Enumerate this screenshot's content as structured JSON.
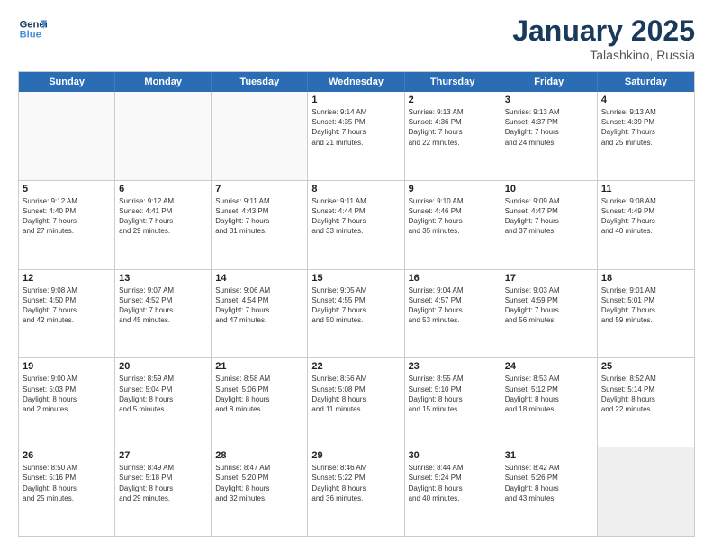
{
  "header": {
    "logo_line1": "General",
    "logo_line2": "Blue",
    "month_year": "January 2025",
    "location": "Talashkino, Russia"
  },
  "weekdays": [
    "Sunday",
    "Monday",
    "Tuesday",
    "Wednesday",
    "Thursday",
    "Friday",
    "Saturday"
  ],
  "rows": [
    [
      {
        "day": "",
        "info": "",
        "empty": true
      },
      {
        "day": "",
        "info": "",
        "empty": true
      },
      {
        "day": "",
        "info": "",
        "empty": true
      },
      {
        "day": "1",
        "info": "Sunrise: 9:14 AM\nSunset: 4:35 PM\nDaylight: 7 hours\nand 21 minutes."
      },
      {
        "day": "2",
        "info": "Sunrise: 9:13 AM\nSunset: 4:36 PM\nDaylight: 7 hours\nand 22 minutes."
      },
      {
        "day": "3",
        "info": "Sunrise: 9:13 AM\nSunset: 4:37 PM\nDaylight: 7 hours\nand 24 minutes."
      },
      {
        "day": "4",
        "info": "Sunrise: 9:13 AM\nSunset: 4:39 PM\nDaylight: 7 hours\nand 25 minutes."
      }
    ],
    [
      {
        "day": "5",
        "info": "Sunrise: 9:12 AM\nSunset: 4:40 PM\nDaylight: 7 hours\nand 27 minutes."
      },
      {
        "day": "6",
        "info": "Sunrise: 9:12 AM\nSunset: 4:41 PM\nDaylight: 7 hours\nand 29 minutes."
      },
      {
        "day": "7",
        "info": "Sunrise: 9:11 AM\nSunset: 4:43 PM\nDaylight: 7 hours\nand 31 minutes."
      },
      {
        "day": "8",
        "info": "Sunrise: 9:11 AM\nSunset: 4:44 PM\nDaylight: 7 hours\nand 33 minutes."
      },
      {
        "day": "9",
        "info": "Sunrise: 9:10 AM\nSunset: 4:46 PM\nDaylight: 7 hours\nand 35 minutes."
      },
      {
        "day": "10",
        "info": "Sunrise: 9:09 AM\nSunset: 4:47 PM\nDaylight: 7 hours\nand 37 minutes."
      },
      {
        "day": "11",
        "info": "Sunrise: 9:08 AM\nSunset: 4:49 PM\nDaylight: 7 hours\nand 40 minutes."
      }
    ],
    [
      {
        "day": "12",
        "info": "Sunrise: 9:08 AM\nSunset: 4:50 PM\nDaylight: 7 hours\nand 42 minutes."
      },
      {
        "day": "13",
        "info": "Sunrise: 9:07 AM\nSunset: 4:52 PM\nDaylight: 7 hours\nand 45 minutes."
      },
      {
        "day": "14",
        "info": "Sunrise: 9:06 AM\nSunset: 4:54 PM\nDaylight: 7 hours\nand 47 minutes."
      },
      {
        "day": "15",
        "info": "Sunrise: 9:05 AM\nSunset: 4:55 PM\nDaylight: 7 hours\nand 50 minutes."
      },
      {
        "day": "16",
        "info": "Sunrise: 9:04 AM\nSunset: 4:57 PM\nDaylight: 7 hours\nand 53 minutes."
      },
      {
        "day": "17",
        "info": "Sunrise: 9:03 AM\nSunset: 4:59 PM\nDaylight: 7 hours\nand 56 minutes."
      },
      {
        "day": "18",
        "info": "Sunrise: 9:01 AM\nSunset: 5:01 PM\nDaylight: 7 hours\nand 59 minutes."
      }
    ],
    [
      {
        "day": "19",
        "info": "Sunrise: 9:00 AM\nSunset: 5:03 PM\nDaylight: 8 hours\nand 2 minutes."
      },
      {
        "day": "20",
        "info": "Sunrise: 8:59 AM\nSunset: 5:04 PM\nDaylight: 8 hours\nand 5 minutes."
      },
      {
        "day": "21",
        "info": "Sunrise: 8:58 AM\nSunset: 5:06 PM\nDaylight: 8 hours\nand 8 minutes."
      },
      {
        "day": "22",
        "info": "Sunrise: 8:56 AM\nSunset: 5:08 PM\nDaylight: 8 hours\nand 11 minutes."
      },
      {
        "day": "23",
        "info": "Sunrise: 8:55 AM\nSunset: 5:10 PM\nDaylight: 8 hours\nand 15 minutes."
      },
      {
        "day": "24",
        "info": "Sunrise: 8:53 AM\nSunset: 5:12 PM\nDaylight: 8 hours\nand 18 minutes."
      },
      {
        "day": "25",
        "info": "Sunrise: 8:52 AM\nSunset: 5:14 PM\nDaylight: 8 hours\nand 22 minutes."
      }
    ],
    [
      {
        "day": "26",
        "info": "Sunrise: 8:50 AM\nSunset: 5:16 PM\nDaylight: 8 hours\nand 25 minutes."
      },
      {
        "day": "27",
        "info": "Sunrise: 8:49 AM\nSunset: 5:18 PM\nDaylight: 8 hours\nand 29 minutes."
      },
      {
        "day": "28",
        "info": "Sunrise: 8:47 AM\nSunset: 5:20 PM\nDaylight: 8 hours\nand 32 minutes."
      },
      {
        "day": "29",
        "info": "Sunrise: 8:46 AM\nSunset: 5:22 PM\nDaylight: 8 hours\nand 36 minutes."
      },
      {
        "day": "30",
        "info": "Sunrise: 8:44 AM\nSunset: 5:24 PM\nDaylight: 8 hours\nand 40 minutes."
      },
      {
        "day": "31",
        "info": "Sunrise: 8:42 AM\nSunset: 5:26 PM\nDaylight: 8 hours\nand 43 minutes."
      },
      {
        "day": "",
        "info": "",
        "empty": true,
        "shaded": true
      }
    ]
  ]
}
